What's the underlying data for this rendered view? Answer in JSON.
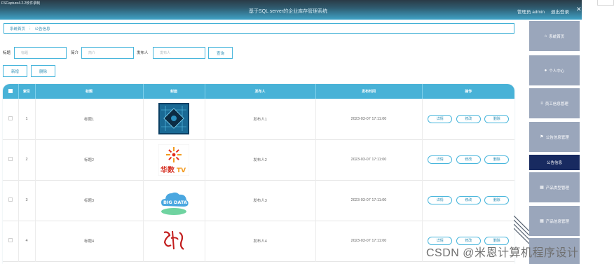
{
  "window": {
    "title": "FSCapture4.2.2软件录制"
  },
  "header": {
    "system_title": "基于SQL server的企业库存管理系统",
    "user_label": "管理员 admin",
    "logout_label": "退出登录",
    "close_glyph": "✕"
  },
  "breadcrumb": {
    "home": "系统首页",
    "separator": "⋮",
    "current": "公告信息"
  },
  "search": {
    "title_label": "标题",
    "title_placeholder": "标题",
    "intro_label": "简介",
    "intro_placeholder": "简介",
    "publisher_label": "发布人",
    "publisher_placeholder": "发布人",
    "query_button": "查询"
  },
  "actions": {
    "add": "新增",
    "delete": "删除"
  },
  "table": {
    "columns": [
      "",
      "索引",
      "标题",
      "封面",
      "发布人",
      "发布时间",
      "操作"
    ],
    "rows": [
      {
        "index": "1",
        "title": "标题1",
        "cover": "chip-image",
        "publisher": "发布人1",
        "time": "2023-03-07 17:11:00"
      },
      {
        "index": "2",
        "title": "标题2",
        "cover": "huashu-tv-logo",
        "publisher": "发布人2",
        "time": "2023-03-07 17:11:00"
      },
      {
        "index": "3",
        "title": "标题3",
        "cover": "big-data-cloud",
        "publisher": "发布人3",
        "time": "2023-03-07 17:11:00"
      },
      {
        "index": "4",
        "title": "标题4",
        "cover": "red-calligraphy",
        "publisher": "发布人4",
        "time": "2023-03-07 17:11:00"
      }
    ],
    "row_actions": {
      "detail": "详情",
      "edit": "修改",
      "delete": "删除"
    }
  },
  "cover_text": {
    "huashu": "华数",
    "huashu_tv": "TV",
    "bigdata": "BIG DATA"
  },
  "sidebar": {
    "items": [
      {
        "label": "系统首页",
        "icon": "home-icon",
        "glyph": "⌂"
      },
      {
        "label": "个人中心",
        "icon": "user-icon",
        "glyph": "●"
      },
      {
        "label": "员工信息管理",
        "icon": "list-icon",
        "glyph": "≡"
      },
      {
        "label": "公告信息管理",
        "icon": "flag-icon",
        "glyph": "⚑"
      },
      {
        "label": "公告信息",
        "icon": "",
        "glyph": ""
      },
      {
        "label": "产品类型管理",
        "icon": "grid-icon",
        "glyph": "▦"
      },
      {
        "label": "产品信息管理",
        "icon": "grid-icon",
        "glyph": "▦"
      }
    ]
  },
  "watermark": "CSDN @米恩计算机程序设计",
  "colors": {
    "accent": "#48b2d7",
    "nav_bg": "#9aa6bb",
    "nav_active": "#182a60"
  }
}
